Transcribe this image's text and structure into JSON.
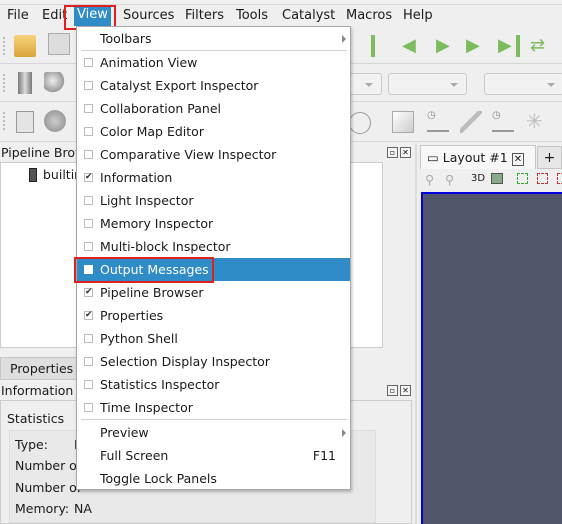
{
  "menubar": {
    "items": [
      "File",
      "Edit",
      "View",
      "Sources",
      "Filters",
      "Tools",
      "Catalyst",
      "Macros",
      "Help"
    ],
    "active": "View"
  },
  "view_menu": {
    "items": [
      {
        "label": "Toolbars",
        "submenu": true
      },
      {
        "label": "Animation View",
        "checked": false
      },
      {
        "label": "Catalyst Export Inspector",
        "checked": false
      },
      {
        "label": "Collaboration Panel",
        "checked": false
      },
      {
        "label": "Color Map Editor",
        "checked": false
      },
      {
        "label": "Comparative View Inspector",
        "checked": false
      },
      {
        "label": "Information",
        "checked": true
      },
      {
        "label": "Light Inspector",
        "checked": false
      },
      {
        "label": "Memory Inspector",
        "checked": false
      },
      {
        "label": "Multi-block Inspector",
        "checked": false
      },
      {
        "label": "Output Messages",
        "checked": false,
        "highlighted": true
      },
      {
        "label": "Pipeline Browser",
        "checked": true
      },
      {
        "label": "Properties",
        "checked": true
      },
      {
        "label": "Python Shell",
        "checked": false
      },
      {
        "label": "Selection Display Inspector",
        "checked": false
      },
      {
        "label": "Statistics Inspector",
        "checked": false
      },
      {
        "label": "Time Inspector",
        "checked": false
      },
      {
        "label": "Preview",
        "submenu": true
      },
      {
        "label": "Full Screen",
        "shortcut": "F11"
      },
      {
        "label": "Toggle Lock Panels"
      }
    ]
  },
  "pipeline": {
    "title": "Pipeline Browser",
    "item": "builtin:"
  },
  "tabs": {
    "properties": "Properties",
    "information": "Information"
  },
  "info": {
    "section": "Statistics",
    "rows": [
      "Type:",
      "Number of",
      "Number of"
    ],
    "type_value": "N",
    "memory_label": "Memory:",
    "memory_value": "NA"
  },
  "layout": {
    "tab": "Layout #1",
    "add": "+",
    "mode": "3D"
  },
  "colors": {
    "highlight": "#308cc6",
    "viewport": "#52566b",
    "viewport_border": "#0000e0",
    "annotation": "#e02020"
  }
}
